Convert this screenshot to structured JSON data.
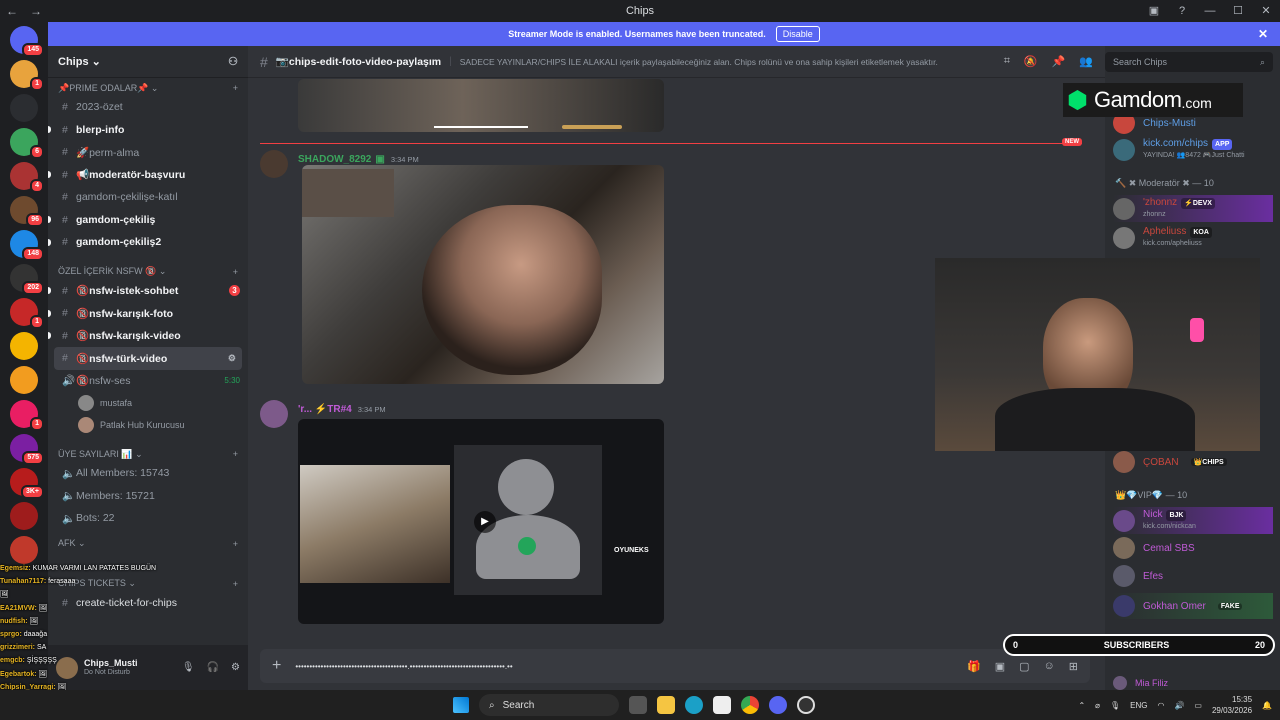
{
  "window": {
    "title": "Chips",
    "nav_back": "←",
    "nav_fwd": "→"
  },
  "servers": [
    {
      "badge": "145",
      "color": "#5865f2"
    },
    {
      "badge": "1",
      "color": "#e8a33d"
    },
    {
      "badge": "",
      "color": "#2b2d31"
    },
    {
      "badge": "6",
      "color": "#3ba55d"
    },
    {
      "badge": "4",
      "color": "#a33"
    },
    {
      "badge": "96",
      "color": "#6e4a2e"
    },
    {
      "badge": "148",
      "color": "#1e88e5"
    },
    {
      "badge": "202",
      "color": "#333"
    },
    {
      "badge": "1",
      "color": "#c62828"
    },
    {
      "badge": "",
      "color": "#f4b400"
    },
    {
      "badge": "",
      "color": "#f29c1f"
    },
    {
      "badge": "1",
      "color": "#e91e63"
    },
    {
      "badge": "575",
      "color": "#7b1fa2"
    },
    {
      "badge": "3K+",
      "color": "#b71c1c"
    },
    {
      "badge": "",
      "color": "#9e1c1c"
    },
    {
      "badge": "",
      "color": "#c0392b"
    }
  ],
  "banner": {
    "text": "Streamer Mode is enabled. Usernames have been truncated.",
    "button": "Disable"
  },
  "guild": {
    "name": "Chips ⌄"
  },
  "categories": {
    "prime": "📌PRIME ODALAR📌 ⌄",
    "nsfw": "ÖZEL İÇERİK NSFW 🔞 ⌄",
    "uye": "Üye Sayıları 📊 ⌄",
    "afk": "AFK ⌄",
    "tickets": "Chips Tickets ⌄"
  },
  "channels": [
    {
      "name": "2023-özet",
      "unread": false
    },
    {
      "name": "blerp-info",
      "unread": true
    },
    {
      "name": "🚀perm-alma",
      "unread": false
    },
    {
      "name": "📢moderatör-başvuru",
      "unread": true
    },
    {
      "name": "gamdom-çekilişe-katıl",
      "unread": false
    },
    {
      "name": "gamdom-çekiliş",
      "unread": true
    },
    {
      "name": "gamdom-çekiliş2",
      "unread": true
    }
  ],
  "nsfw_channels": [
    {
      "name": "🔞nsfw-istek-sohbet",
      "count": "3"
    },
    {
      "name": "🔞nsfw-karışık-foto",
      "count": ""
    },
    {
      "name": "🔞nsfw-karışık-video",
      "count": ""
    },
    {
      "name": "🔞nsfw-türk-video",
      "count": ""
    }
  ],
  "voice": {
    "name": "🔞nsfw-ses",
    "time": "5:30",
    "users": [
      "mustafa",
      "Patlak Hub Kurucusu"
    ]
  },
  "stats": [
    "All Members: 15743",
    "Members: 15721",
    "Bots: 22"
  ],
  "ticket_channel": "create-ticket-for-chips",
  "userbar": {
    "name": "Chips_Musti",
    "status": "Do Not Disturb"
  },
  "stream_chat": [
    {
      "user": "Egemsiz",
      "text": "KUMAR VARMI LAN PATATES BUGÜN"
    },
    {
      "user": "Tunahan7117",
      "text": "ferasaaa"
    },
    {
      "user": "",
      "text": "🖼"
    },
    {
      "user": "EA21MVW",
      "text": "🖼"
    },
    {
      "user": "nudfish",
      "text": "🖼"
    },
    {
      "user": "sprgo",
      "text": "daaağa"
    },
    {
      "user": "grizzimeri",
      "text": "SA"
    },
    {
      "user": "emgcb",
      "text": "ŞİŞŞŞŞŞ"
    },
    {
      "user": "Egebartok",
      "text": "🖼"
    },
    {
      "user": "Chipsin_Yarragi",
      "text": "🖼"
    },
    {
      "user": "OsirisQ",
      "text": "🖼"
    },
    {
      "user": "dmadrenaline",
      "text": "🖼"
    }
  ],
  "header": {
    "channel": "📷chips-edit-foto-video-paylaşım",
    "topic": "SADECE YAYINLAR/CHIPS İLE ALAKALI içerik paylaşabileceğiniz alan. Chips rolünü ve ona sahip kişileri etiketlemek yasaktır."
  },
  "messages": [
    {
      "author": "SHADOW_8292",
      "time": "3:34 PM"
    },
    {
      "author": "'r... ⚡TR#4",
      "time": "3:34 PM"
    }
  ],
  "new_tag": "NEW",
  "embed": {
    "logo": "OYUNEKS"
  },
  "composer": {
    "text": "••••••••••••••••••••••••••••••••••••••••.••••••••••••••••••••••••••••••••••.••"
  },
  "search": {
    "placeholder": "Search Chips"
  },
  "members": {
    "top": [
      {
        "name": "Chips-Musti",
        "sub": "",
        "color": "#5e9ee6"
      },
      {
        "name": "kick.com/chips",
        "sub": "YAYINDA! 👥8472 🎮Just Chatti",
        "color": "#5e9ee6",
        "tag": "APP"
      }
    ],
    "mod_header": "🔨 ✖ Moderatör ✖ — 10",
    "mods": [
      {
        "name": "'zhonnz",
        "sub": "zhonnz",
        "color": "#c8473d",
        "tag": "⚡DEVX"
      },
      {
        "name": "Apheliuss",
        "sub": "kick.com/apheliuss",
        "color": "#c8473d",
        "tag": "KOA"
      }
    ],
    "coban": {
      "name": "ÇOBAN",
      "tag": "👑CHIPS",
      "color": "#c8473d"
    },
    "vip_header": "👑💎VIP💎 — 10",
    "vips": [
      {
        "name": "Nick",
        "sub": "kick.com/nickcan",
        "color": "#c05bd6",
        "tag": "BJK"
      },
      {
        "name": "Cemal SBS",
        "sub": "",
        "color": "#c05bd6"
      },
      {
        "name": "Efes",
        "sub": "",
        "color": "#c05bd6"
      },
      {
        "name": "Gokhan Omer",
        "sub": "",
        "color": "#c05bd6",
        "tag": "FAKE"
      },
      {
        "name": "Mia Filiz",
        "sub": "",
        "color": "#c05bd6"
      }
    ]
  },
  "overlay": {
    "gamdom": "Gamdom",
    "gamdom_com": ".com"
  },
  "subs": {
    "left": "0",
    "label": "SUBSCRIBERS",
    "right": "20"
  },
  "taskbar": {
    "search": "Search",
    "lang": "ENG",
    "time": "15:35",
    "date": "29/03/2026"
  }
}
